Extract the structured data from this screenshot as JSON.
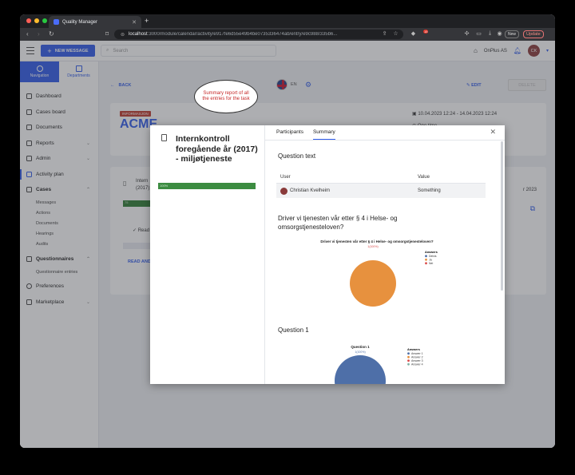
{
  "browser": {
    "tab_title": "Quality Manager",
    "url_host": "localhost",
    "url_path": ":3000/module/calendar/activity/e917fe6d55e49b4be0735336474ab/entry/e9c988/335b6...",
    "new_label": "New",
    "update_label": "Update",
    "ext_badge": "15"
  },
  "header": {
    "new_message": "NEW MESSAGE",
    "search_placeholder": "Search",
    "company": "OnPlus AS",
    "avatar_initials": "CK"
  },
  "sidebar": {
    "tab_navigation": "Navigation",
    "tab_departments": "Departments",
    "items": [
      {
        "label": "Dashboard"
      },
      {
        "label": "Cases board"
      },
      {
        "label": "Documents"
      },
      {
        "label": "Reports"
      },
      {
        "label": "Admin"
      },
      {
        "label": "Activity plan"
      },
      {
        "label": "Cases"
      },
      {
        "label": "Questionnaires"
      },
      {
        "label": "Preferences"
      },
      {
        "label": "Marketplace"
      }
    ],
    "cases_sub": [
      "Messages",
      "Actions",
      "Documents",
      "Hearings",
      "Audits"
    ],
    "questionnaire_sub": [
      "Questionnaire entries"
    ]
  },
  "main": {
    "back": "BACK",
    "lang": "EN",
    "edit": "EDIT",
    "delete": "DELETE",
    "tag": "INFORMASJON",
    "company_title": "ACME",
    "dates": "10.04.2023 12:24 - 14.04.2023 12:24",
    "one_time": "One time",
    "bg_title_1": "Intern",
    "bg_title_2": "(2017)",
    "bg_bar_label": "75",
    "bg_date": "r 2023",
    "bg_read": "Read a",
    "bg_read_link": "READ AND"
  },
  "modal": {
    "title": "Internkontroll foregående år (2017) - miljøtjeneste",
    "progress_label": "100%",
    "tabs": [
      "Participants",
      "Summary"
    ],
    "active_tab": "Summary",
    "question_text_heading": "Question text",
    "table": {
      "headers": [
        "User",
        "Value"
      ],
      "rows": [
        [
          "Christian Kvelheim",
          "Something"
        ]
      ]
    },
    "question_2": "Driver vi tjenesten vår etter § 4 i Helse- og omsorgstjenesteloven?",
    "callout": "Summary report of all the entries for the task",
    "question_3": "Question 1"
  },
  "chart_data": [
    {
      "type": "pie",
      "title": "Driver vi tjenesten vår etter § 4 i Helse- og omsorgstjenesteloven?",
      "legend_title": "Answers",
      "categories": [
        "Delvis",
        "Ja",
        "Nei"
      ],
      "values": [
        0,
        100,
        0
      ],
      "data_label": "1(100%)",
      "colors": [
        "#4e6fa8",
        "#e7913e",
        "#d94a4a"
      ],
      "legend": "right"
    },
    {
      "type": "pie",
      "title": "Question 1",
      "legend_title": "Answers",
      "categories": [
        "Answer 1",
        "Answer 2",
        "Answer 3",
        "Answer 4"
      ],
      "values": [
        100,
        0,
        0,
        0
      ],
      "data_label": "1(100%)",
      "colors": [
        "#4e6fa8",
        "#e7913e",
        "#d94a4a",
        "#7fb3a6"
      ],
      "legend": "right"
    }
  ]
}
